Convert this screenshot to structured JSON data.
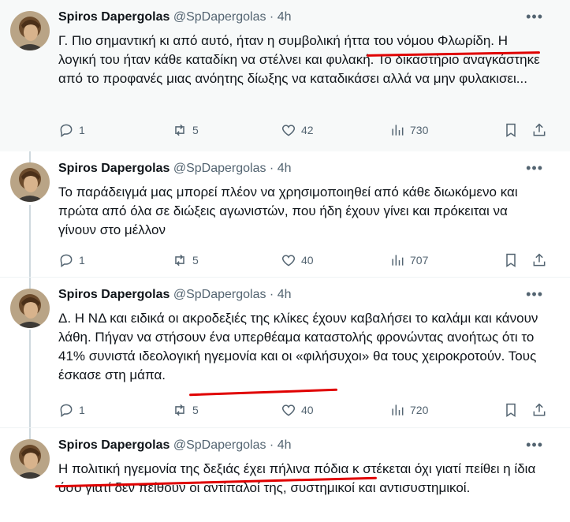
{
  "tweets": [
    {
      "name": "Spiros Dapergolas",
      "handle": "@SpDapergolas",
      "sep": "·",
      "time": "4h",
      "text": "Γ. Πιο σημαντική κι από αυτό, ήταν η συμβολική ήττα του νόμου Φλωρίδη. Η λογική του ήταν κάθε καταδίκη να στέλνει και φυλακή. Το δικαστήριο αναγκάστηκε από το προφανές μιας ανόητης δίωξης να καταδικάσει αλλά να μην φυλακισει...",
      "replies": "1",
      "retweets": "5",
      "likes": "42",
      "views": "730"
    },
    {
      "name": "Spiros Dapergolas",
      "handle": "@SpDapergolas",
      "sep": "·",
      "time": "4h",
      "text": "Το παράδειγμά μας μπορεί πλέον να χρησιμοποιηθεί από κάθε διωκόμενο και πρώτα από όλα σε διώξεις αγωνιστών, που ήδη έχουν γίνει και πρόκειται να γίνουν στο μέλλον",
      "replies": "1",
      "retweets": "5",
      "likes": "40",
      "views": "707"
    },
    {
      "name": "Spiros Dapergolas",
      "handle": "@SpDapergolas",
      "sep": "·",
      "time": "4h",
      "text": "Δ. Η ΝΔ και ειδικά οι ακροδεξιές της κλίκες έχουν καβαλήσει το καλάμι και κάνουν λάθη. Πήγαν να στήσουν ένα υπερθέαμα καταστολής φρονώντας ανοήτως ότι το 41% συνιστά ιδεολογική ηγεμονία και οι «φιλήσυχοι» θα τους χειροκροτούν. Τους έσκασε στη μάπα.",
      "replies": "1",
      "retweets": "5",
      "likes": "40",
      "views": "720"
    },
    {
      "name": "Spiros Dapergolas",
      "handle": "@SpDapergolas",
      "sep": "·",
      "time": "4h",
      "text": "Η πολιτική ηγεμονία της δεξιάς έχει πήλινα πόδια κ στέκεται όχι γιατί πείθει η ίδια όσο γιατί δεν πείθουν οι αντίπαλοί της, συστημικοί και αντισυστημικοί."
    }
  ],
  "icons": {
    "reply": "reply-icon",
    "retweet": "retweet-icon",
    "like": "heart-icon",
    "views": "views-icon",
    "bookmark": "bookmark-icon",
    "share": "share-icon",
    "more": "more-icon"
  },
  "colors": {
    "secondary_text": "#536471",
    "thread_line": "#cfd9de",
    "highlight_underline": "#e00000"
  }
}
